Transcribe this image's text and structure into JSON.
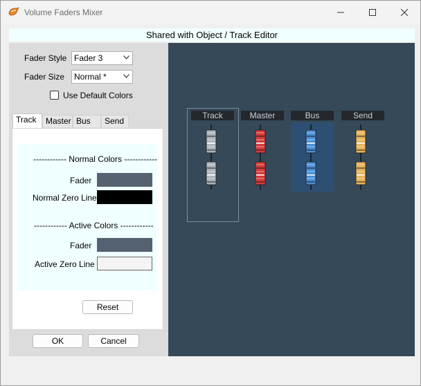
{
  "window": {
    "title": "Volume Faders Mixer",
    "icon": "orange-app-icon",
    "minimize_icon": "minimize-icon",
    "maximize_icon": "maximize-icon",
    "close_icon": "close-icon"
  },
  "header": {
    "text": "Shared with Object / Track Editor"
  },
  "settings": {
    "fader_style_label": "Fader Style",
    "fader_style_value": "Fader 3",
    "fader_size_label": "Fader Size",
    "fader_size_value": "Normal *",
    "use_default_colors_label": "Use Default Colors",
    "use_default_colors_checked": false
  },
  "tabs": [
    {
      "label": "Track",
      "active": true
    },
    {
      "label": "Master",
      "active": false
    },
    {
      "label": "Bus",
      "active": false
    },
    {
      "label": "Send",
      "active": false
    }
  ],
  "colors": {
    "normal_header": "------------  Normal Colors  ------------",
    "fader_label": "Fader",
    "normal_fader_color": "#566270",
    "normal_zero_label": "Normal Zero Line",
    "normal_zero_color": "#000000",
    "active_header": "------------  Active Colors  ------------",
    "active_fader_label": "Fader",
    "active_fader_color": "#546170",
    "active_zero_label": "Active Zero Line",
    "active_zero_color": "#f4f4f4"
  },
  "buttons": {
    "reset": "Reset",
    "ok": "OK",
    "cancel": "Cancel"
  },
  "preview": {
    "groups": [
      {
        "label": "Track",
        "selected": true,
        "fader_color": "#aeb4bc",
        "accent": "#d8dde2"
      },
      {
        "label": "Master",
        "selected": false,
        "fader_color": "#d63a3a",
        "accent": "#f1a0a0"
      },
      {
        "label": "Bus",
        "selected": false,
        "highlighted": true,
        "fader_color": "#4a8fd6",
        "accent": "#a9cdf1"
      },
      {
        "label": "Send",
        "selected": false,
        "fader_color": "#e7b35a",
        "accent": "#f5dba9"
      }
    ]
  }
}
